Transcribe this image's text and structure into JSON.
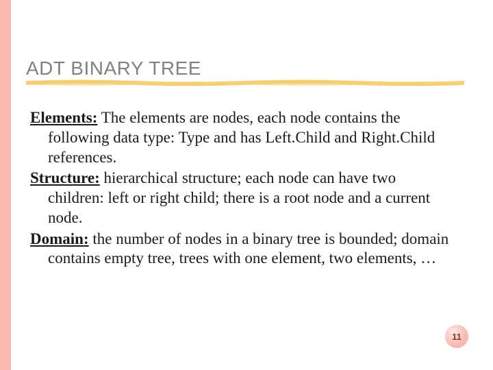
{
  "colors": {
    "sidebar": "#f7b9b2",
    "title": "#7d8283",
    "highlight": "#f3c65b",
    "page_number_bg": "#f8bdb5",
    "page_number_text": "#7a3d36"
  },
  "header": {
    "title": "ADT BINARY TREE"
  },
  "body": {
    "paragraphs": [
      {
        "lead": "Elements:",
        "text": " The elements are nodes, each node contains the following data type: Type and has Left.Child and Right.Child references.",
        "highlighted_first_line": true
      },
      {
        "lead": "Structure:",
        "text": " hierarchical structure; each node can have two children: left or right child; there is a root node and a current node.",
        "highlighted_first_line": false
      },
      {
        "lead": "Domain:",
        "text": " the number of nodes in a binary tree is bounded; domain contains empty tree, trees with one element, two elements, …",
        "highlighted_first_line": false
      }
    ]
  },
  "footer": {
    "page_number": "11"
  }
}
